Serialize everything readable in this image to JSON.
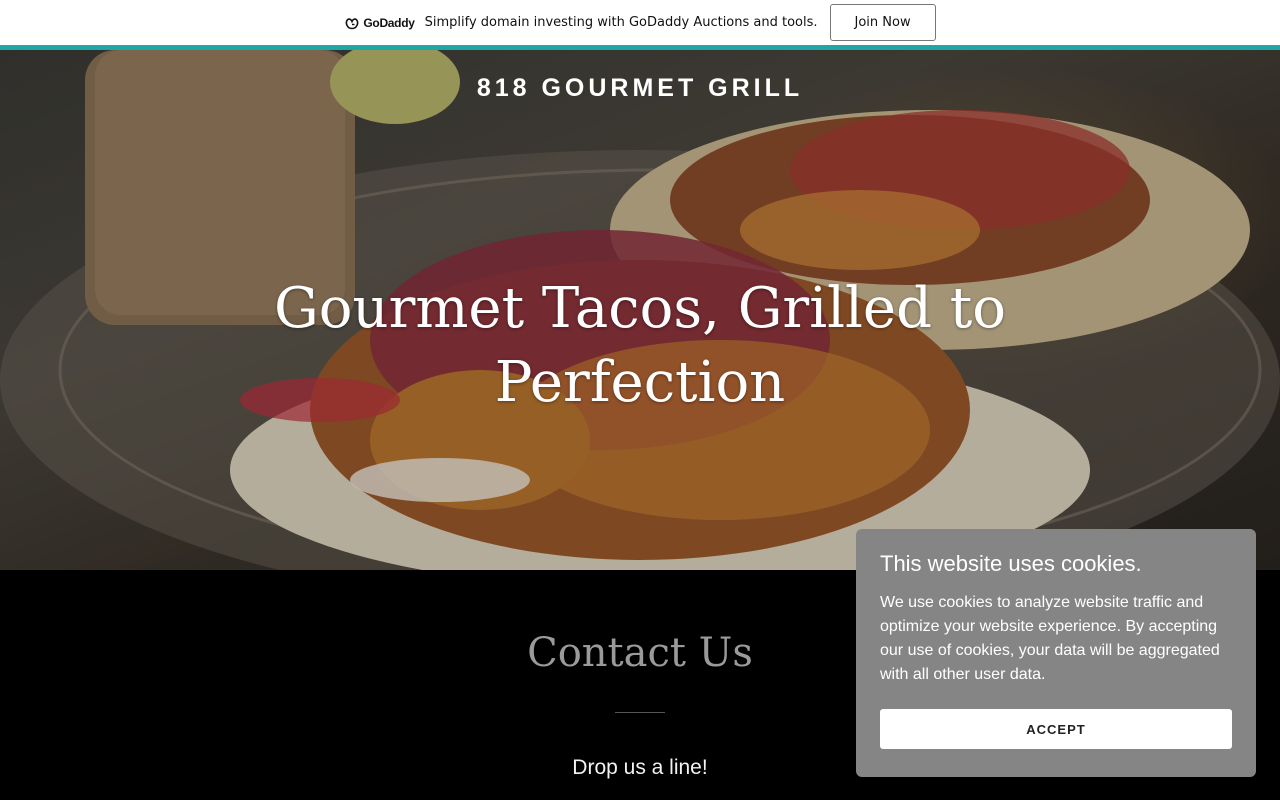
{
  "promo": {
    "logo_text": "GoDaddy",
    "message": "Simplify domain investing with GoDaddy Auctions and tools.",
    "cta_label": "Join Now",
    "accent_color": "#1fa6a6"
  },
  "hero": {
    "brand": "818 GOURMET GRILL",
    "headline": "Gourmet Tacos, Grilled to Perfection"
  },
  "contact": {
    "title": "Contact Us",
    "subtitle": "Drop us a line!"
  },
  "cookie_banner": {
    "title": "This website uses cookies.",
    "body": "We use cookies to analyze website traffic and optimize your website experience. By accepting our use of cookies, your data will be aggregated with all other user data.",
    "accept_label": "ACCEPT"
  },
  "colors": {
    "page_background": "#000000",
    "cookie_background": "#858585",
    "contact_title": "#9a9a9a"
  }
}
